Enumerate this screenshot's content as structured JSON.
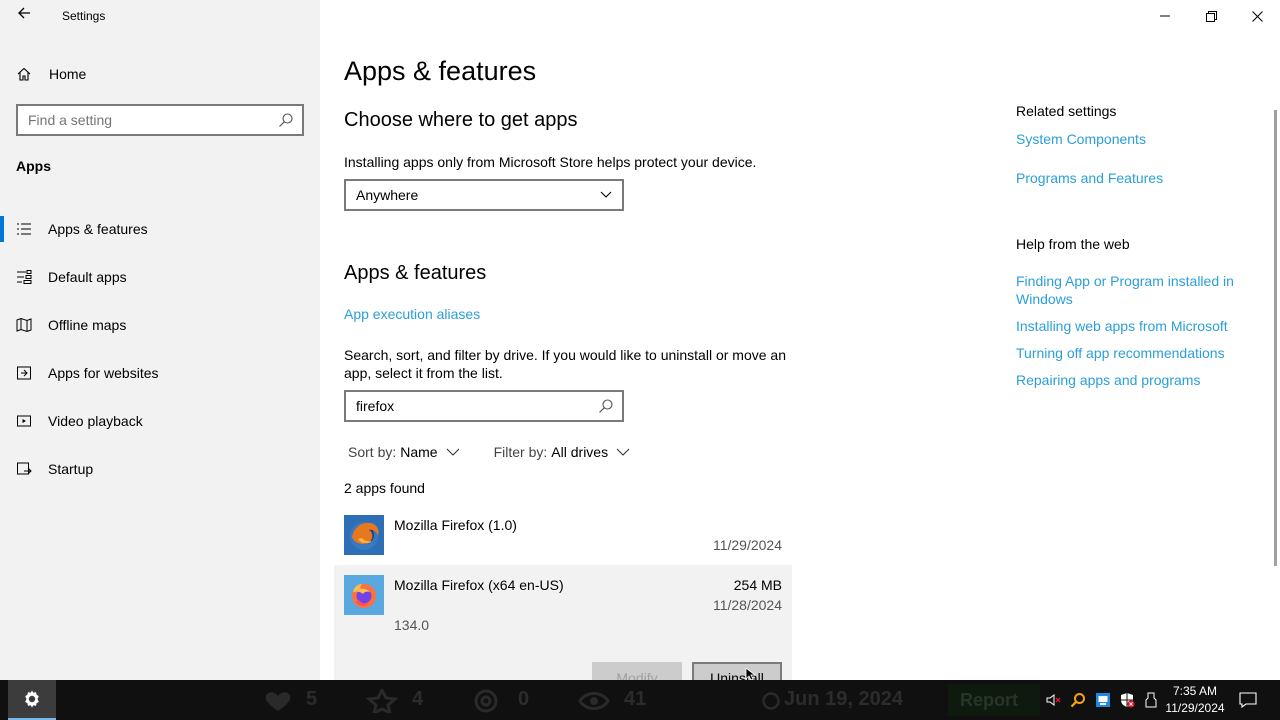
{
  "window": {
    "title": "Settings",
    "minimize": "—",
    "restore": "❐",
    "close": "✕"
  },
  "sidebar": {
    "home_label": "Home",
    "search_placeholder": "Find a setting",
    "section": "Apps",
    "items": [
      {
        "label": "Apps & features",
        "icon": "list-icon",
        "active": true
      },
      {
        "label": "Default apps",
        "icon": "default-apps-icon"
      },
      {
        "label": "Offline maps",
        "icon": "map-icon"
      },
      {
        "label": "Apps for websites",
        "icon": "web-app-icon"
      },
      {
        "label": "Video playback",
        "icon": "video-icon"
      },
      {
        "label": "Startup",
        "icon": "startup-icon"
      }
    ]
  },
  "main": {
    "page_title": "Apps & features",
    "choose_heading": "Choose where to get apps",
    "choose_desc": "Installing apps only from Microsoft Store helps protect your device.",
    "source_selected": "Anywhere",
    "apps_heading": "Apps & features",
    "aliases_link": "App execution aliases",
    "filter_desc": "Search, sort, and filter by drive. If you would like to uninstall or move an app, select it from the list.",
    "filter_value": "firefox",
    "sort_label": "Sort by:",
    "sort_value": "Name",
    "filter_label": "Filter by:",
    "filter_drive": "All drives",
    "count": "2 apps found",
    "apps": [
      {
        "name": "Mozilla Firefox (1.0)",
        "date": "11/29/2024"
      },
      {
        "name": "Mozilla Firefox (x64 en-US)",
        "size": "254 MB",
        "date": "11/28/2024",
        "version": "134.0"
      }
    ],
    "modify_label": "Modify",
    "uninstall_label": "Uninstall"
  },
  "related": {
    "heading": "Related settings",
    "links": [
      "System Components",
      "Programs and Features"
    ],
    "help_heading": "Help from the web",
    "help_links": [
      "Finding App or Program installed in Windows",
      "Installing web apps from Microsoft",
      "Turning off app recommendations",
      "Repairing apps and programs"
    ]
  },
  "taskbar": {
    "time": "7:35 AM",
    "date": "11/29/2024",
    "bg_stats": [
      "5",
      "4",
      "0",
      "41"
    ],
    "bg_date": "Jun 19, 2024",
    "bg_report": "Report"
  },
  "colors": {
    "accent": "#0078d7",
    "link": "#2b9fd8",
    "sidebar_bg": "#f2f2f2",
    "taskbar_bg": "#101010"
  }
}
